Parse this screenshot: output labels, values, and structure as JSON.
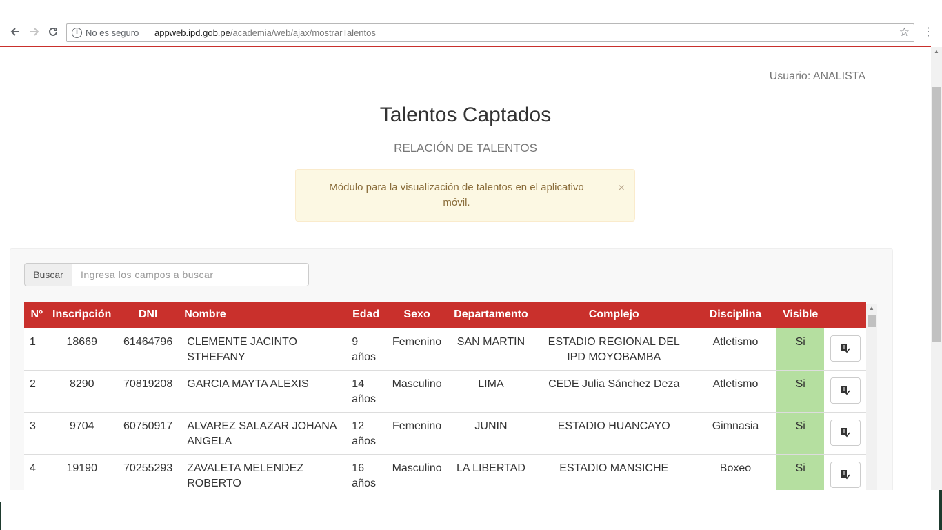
{
  "browser": {
    "security_label": "No es seguro",
    "url_host": "appweb.ipd.gob.pe",
    "url_path": "/academia/web/ajax/mostrarTalentos"
  },
  "header": {
    "user_label": "Usuario: ANALISTA",
    "title": "Talentos Captados",
    "subtitle": "RELACIÓN DE TALENTOS"
  },
  "alert": {
    "message": "Módulo para la visualización de talentos en el aplicativo móvil.",
    "close": "×"
  },
  "search": {
    "addon_label": "Buscar",
    "placeholder": "Ingresa los campos a buscar"
  },
  "table": {
    "headers": [
      "Nº",
      "Inscripción",
      "DNI",
      "Nombre",
      "Edad",
      "Sexo",
      "Departamento",
      "Complejo",
      "Disciplina",
      "Visible"
    ],
    "rows": [
      {
        "num": "1",
        "inscripcion": "18669",
        "dni": "61464796",
        "nombre": "CLEMENTE JACINTO STHEFANY",
        "edad": "9 años",
        "sexo": "Femenino",
        "departamento": "SAN MARTIN",
        "complejo": "ESTADIO REGIONAL DEL IPD MOYOBAMBA",
        "disciplina": "Atletismo",
        "visible": "Si"
      },
      {
        "num": "2",
        "inscripcion": "8290",
        "dni": "70819208",
        "nombre": "GARCIA MAYTA ALEXIS",
        "edad": "14 años",
        "sexo": "Masculino",
        "departamento": "LIMA",
        "complejo": "CEDE Julia Sánchez Deza",
        "disciplina": "Atletismo",
        "visible": "Si"
      },
      {
        "num": "3",
        "inscripcion": "9704",
        "dni": "60750917",
        "nombre": "ALVAREZ SALAZAR JOHANA ANGELA",
        "edad": "12 años",
        "sexo": "Femenino",
        "departamento": "JUNIN",
        "complejo": "ESTADIO HUANCAYO",
        "disciplina": "Gimnasia",
        "visible": "Si"
      },
      {
        "num": "4",
        "inscripcion": "19190",
        "dni": "70255293",
        "nombre": "ZAVALETA MELENDEZ ROBERTO",
        "edad": "16 años",
        "sexo": "Masculino",
        "departamento": "LA LIBERTAD",
        "complejo": "ESTADIO MANSICHE",
        "disciplina": "Boxeo",
        "visible": "Si"
      }
    ]
  },
  "colors": {
    "header_red": "#c9302c",
    "visible_green": "#b5dfa0",
    "alert_bg": "#fcf8e3"
  },
  "icons": [
    "back-icon",
    "forward-icon",
    "reload-icon",
    "info-icon",
    "star-icon",
    "menu-icon",
    "edit-icon"
  ]
}
